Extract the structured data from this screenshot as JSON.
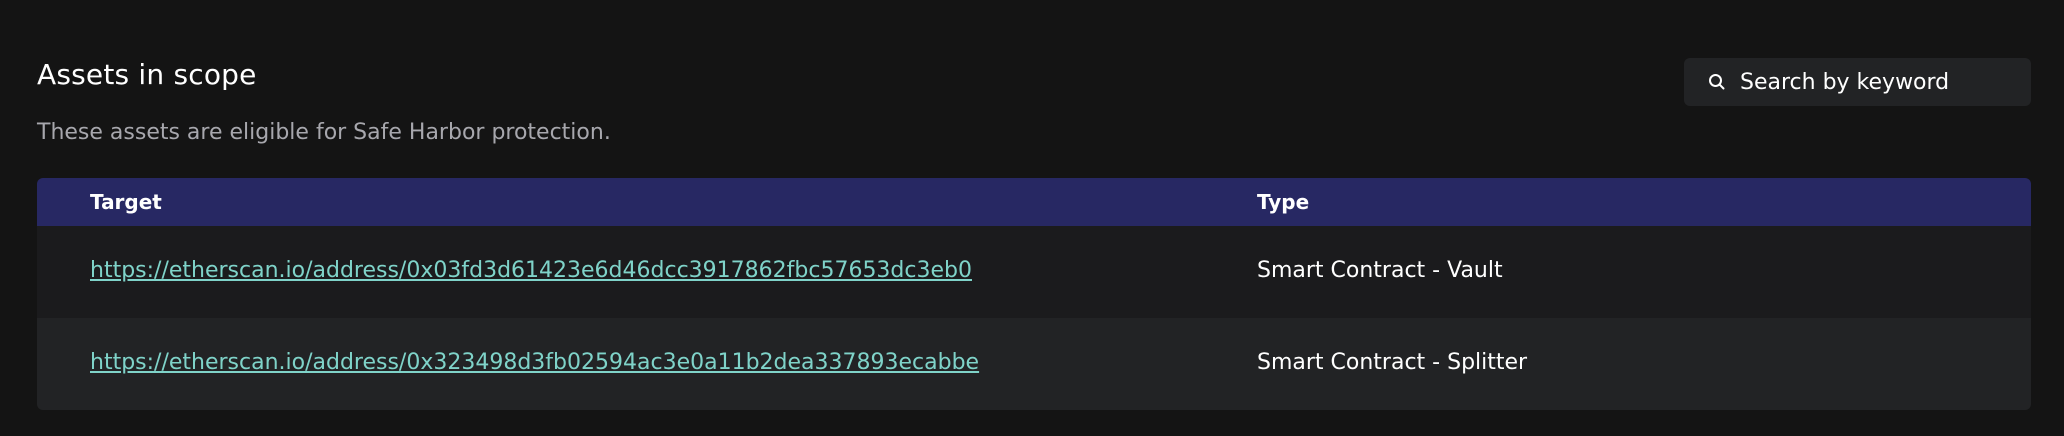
{
  "section": {
    "title": "Assets in scope",
    "subtitle": "These assets are eligible for Safe Harbor protection."
  },
  "search": {
    "placeholder": "Search by keyword",
    "icon": "search-icon"
  },
  "table": {
    "headers": {
      "target": "Target",
      "type": "Type"
    },
    "rows": [
      {
        "target": "https://etherscan.io/address/0x03fd3d61423e6d46dcc3917862fbc57653dc3eb0",
        "type": "Smart Contract - Vault"
      },
      {
        "target": "https://etherscan.io/address/0x323498d3fb02594ac3e0a11b2dea337893ecabbe",
        "type": "Smart Contract - Splitter"
      }
    ]
  },
  "colors": {
    "background": "#141414",
    "header_bg": "#272863",
    "link": "#7fd3c9",
    "search_bg": "#222325",
    "row_alt": "#222325"
  }
}
